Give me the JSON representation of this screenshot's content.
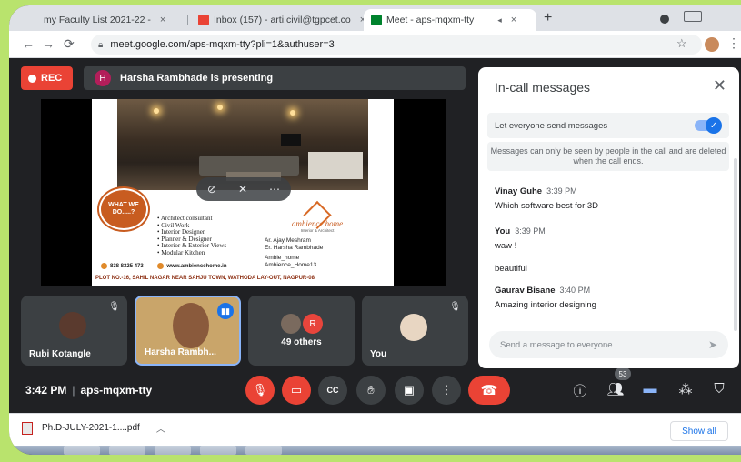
{
  "browser": {
    "tabs": [
      {
        "label": "my Faculty List 2021-22 -",
        "close": "×"
      },
      {
        "label": "Inbox (157) - arti.civil@tgpcet.co",
        "close": "×"
      },
      {
        "label": "Meet - aps-mqxm-tty",
        "close": "×"
      }
    ],
    "new_tab": "+",
    "url": "meet.google.com/aps-mqxm-tty?pli=1&authuser=3",
    "back_icon": "←",
    "forward_icon": "→",
    "reload_icon": "⟳"
  },
  "meet": {
    "rec_label": "REC",
    "presenter_initial": "H",
    "presenting_text": "Harsha Rambhade is presenting",
    "slide": {
      "badge": "WHAT WE DO.....?",
      "services": [
        "Architect consultant",
        "Civil Work",
        "Interior Designer",
        "Planner & Designer",
        "Interior & Exterior Views",
        "Modular Kitchen"
      ],
      "brand_name": "ambience home",
      "brand_tag": "Interior & Architect",
      "names": [
        "Ar. Ajay Meshram",
        "Er. Harsha Rambhade"
      ],
      "handles": [
        "Ambie_home",
        "Ambience_Home13"
      ],
      "phone": "838 8325 473",
      "website": "www.ambiencehome.in",
      "address": "PLOT NO.-16, SAHIL NAGAR NEAR SAHJU TOWN, WATHODA LAY-OUT, NAGPUR-08"
    },
    "tiles": [
      {
        "name": "Rubi Kotangle"
      },
      {
        "name": "Harsha Rambh..."
      },
      {
        "name": "49 others",
        "avatar_initial": "R"
      },
      {
        "name": "You"
      }
    ],
    "time": "3:42 PM",
    "meeting_code": "aps-mqxm-tty",
    "people_count": "53"
  },
  "chat": {
    "title": "In-call messages",
    "toggle_label": "Let everyone send messages",
    "note": "Messages can only be seen by people in the call and are deleted when the call ends.",
    "messages": [
      {
        "who": "Vinay Guhe",
        "time": "3:39 PM",
        "lines": [
          "Which software best for 3D"
        ]
      },
      {
        "who": "You",
        "time": "3:39 PM",
        "lines": [
          "waw !",
          "beautiful"
        ]
      },
      {
        "who": "Gaurav Bisane",
        "time": "3:40 PM",
        "lines": [
          "Amazing interior designing"
        ]
      }
    ],
    "input_placeholder": "Send a message to everyone"
  },
  "downloads": {
    "file": "Ph.D-JULY-2021-1....pdf",
    "show_all": "Show all"
  },
  "colors": {
    "meet_bg": "#202124",
    "tile_bg": "#3c4043",
    "danger": "#ea4335",
    "accent": "#1a73e8",
    "outer_bg": "#b9e36d"
  }
}
